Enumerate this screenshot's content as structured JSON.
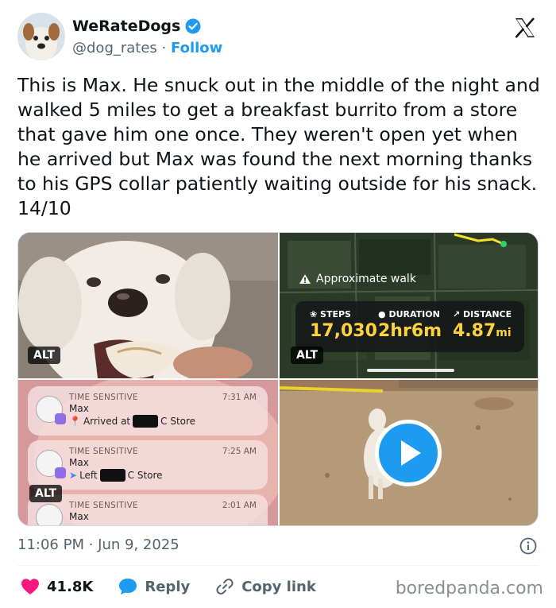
{
  "author": {
    "display_name": "WeRateDogs",
    "handle": "@dog_rates",
    "separator": "·",
    "follow_label": "Follow",
    "avatar_icon": "dog-avatar"
  },
  "tweet": {
    "text": "This is Max. He snuck out in the middle of the night and walked 5 miles to get a breakfast burrito from a store that gave him one once. They weren't open yet when he arrived but Max was found the next morning thanks to his GPS collar patiently waiting outside for his snack. 14/10"
  },
  "media": {
    "alt_label": "ALT",
    "map": {
      "title": "Approximate walk",
      "steps_label": "STEPS",
      "steps_value": "17,030",
      "duration_label": "DURATION",
      "duration_value": "2hr6m",
      "distance_label": "DISTANCE",
      "distance_value": "4.87",
      "distance_unit": "mi"
    },
    "notifications": [
      {
        "tag": "TIME SENSITIVE",
        "time": "7:31 AM",
        "title": "Max",
        "body_prefix": "Arrived at",
        "body_suffix": "C Store",
        "icon": "pin-icon"
      },
      {
        "tag": "TIME SENSITIVE",
        "time": "7:25 AM",
        "title": "Max",
        "body_prefix": "Left",
        "body_suffix": "C Store",
        "icon": "arrow-icon"
      },
      {
        "tag": "TIME SENSITIVE",
        "time": "2:01 AM",
        "title": "Max",
        "body_prefix": "",
        "body_suffix": "",
        "icon": "pin-icon"
      }
    ]
  },
  "meta": {
    "timestamp": "11:06 PM · Jun 9, 2025"
  },
  "actions": {
    "like_count": "41.8K",
    "reply_label": "Reply",
    "copy_link_label": "Copy link"
  },
  "watermark": "boredpanda.com",
  "colors": {
    "accent": "#1d9bf0",
    "like": "#f91880",
    "stat_yellow": "#ffd23c"
  }
}
